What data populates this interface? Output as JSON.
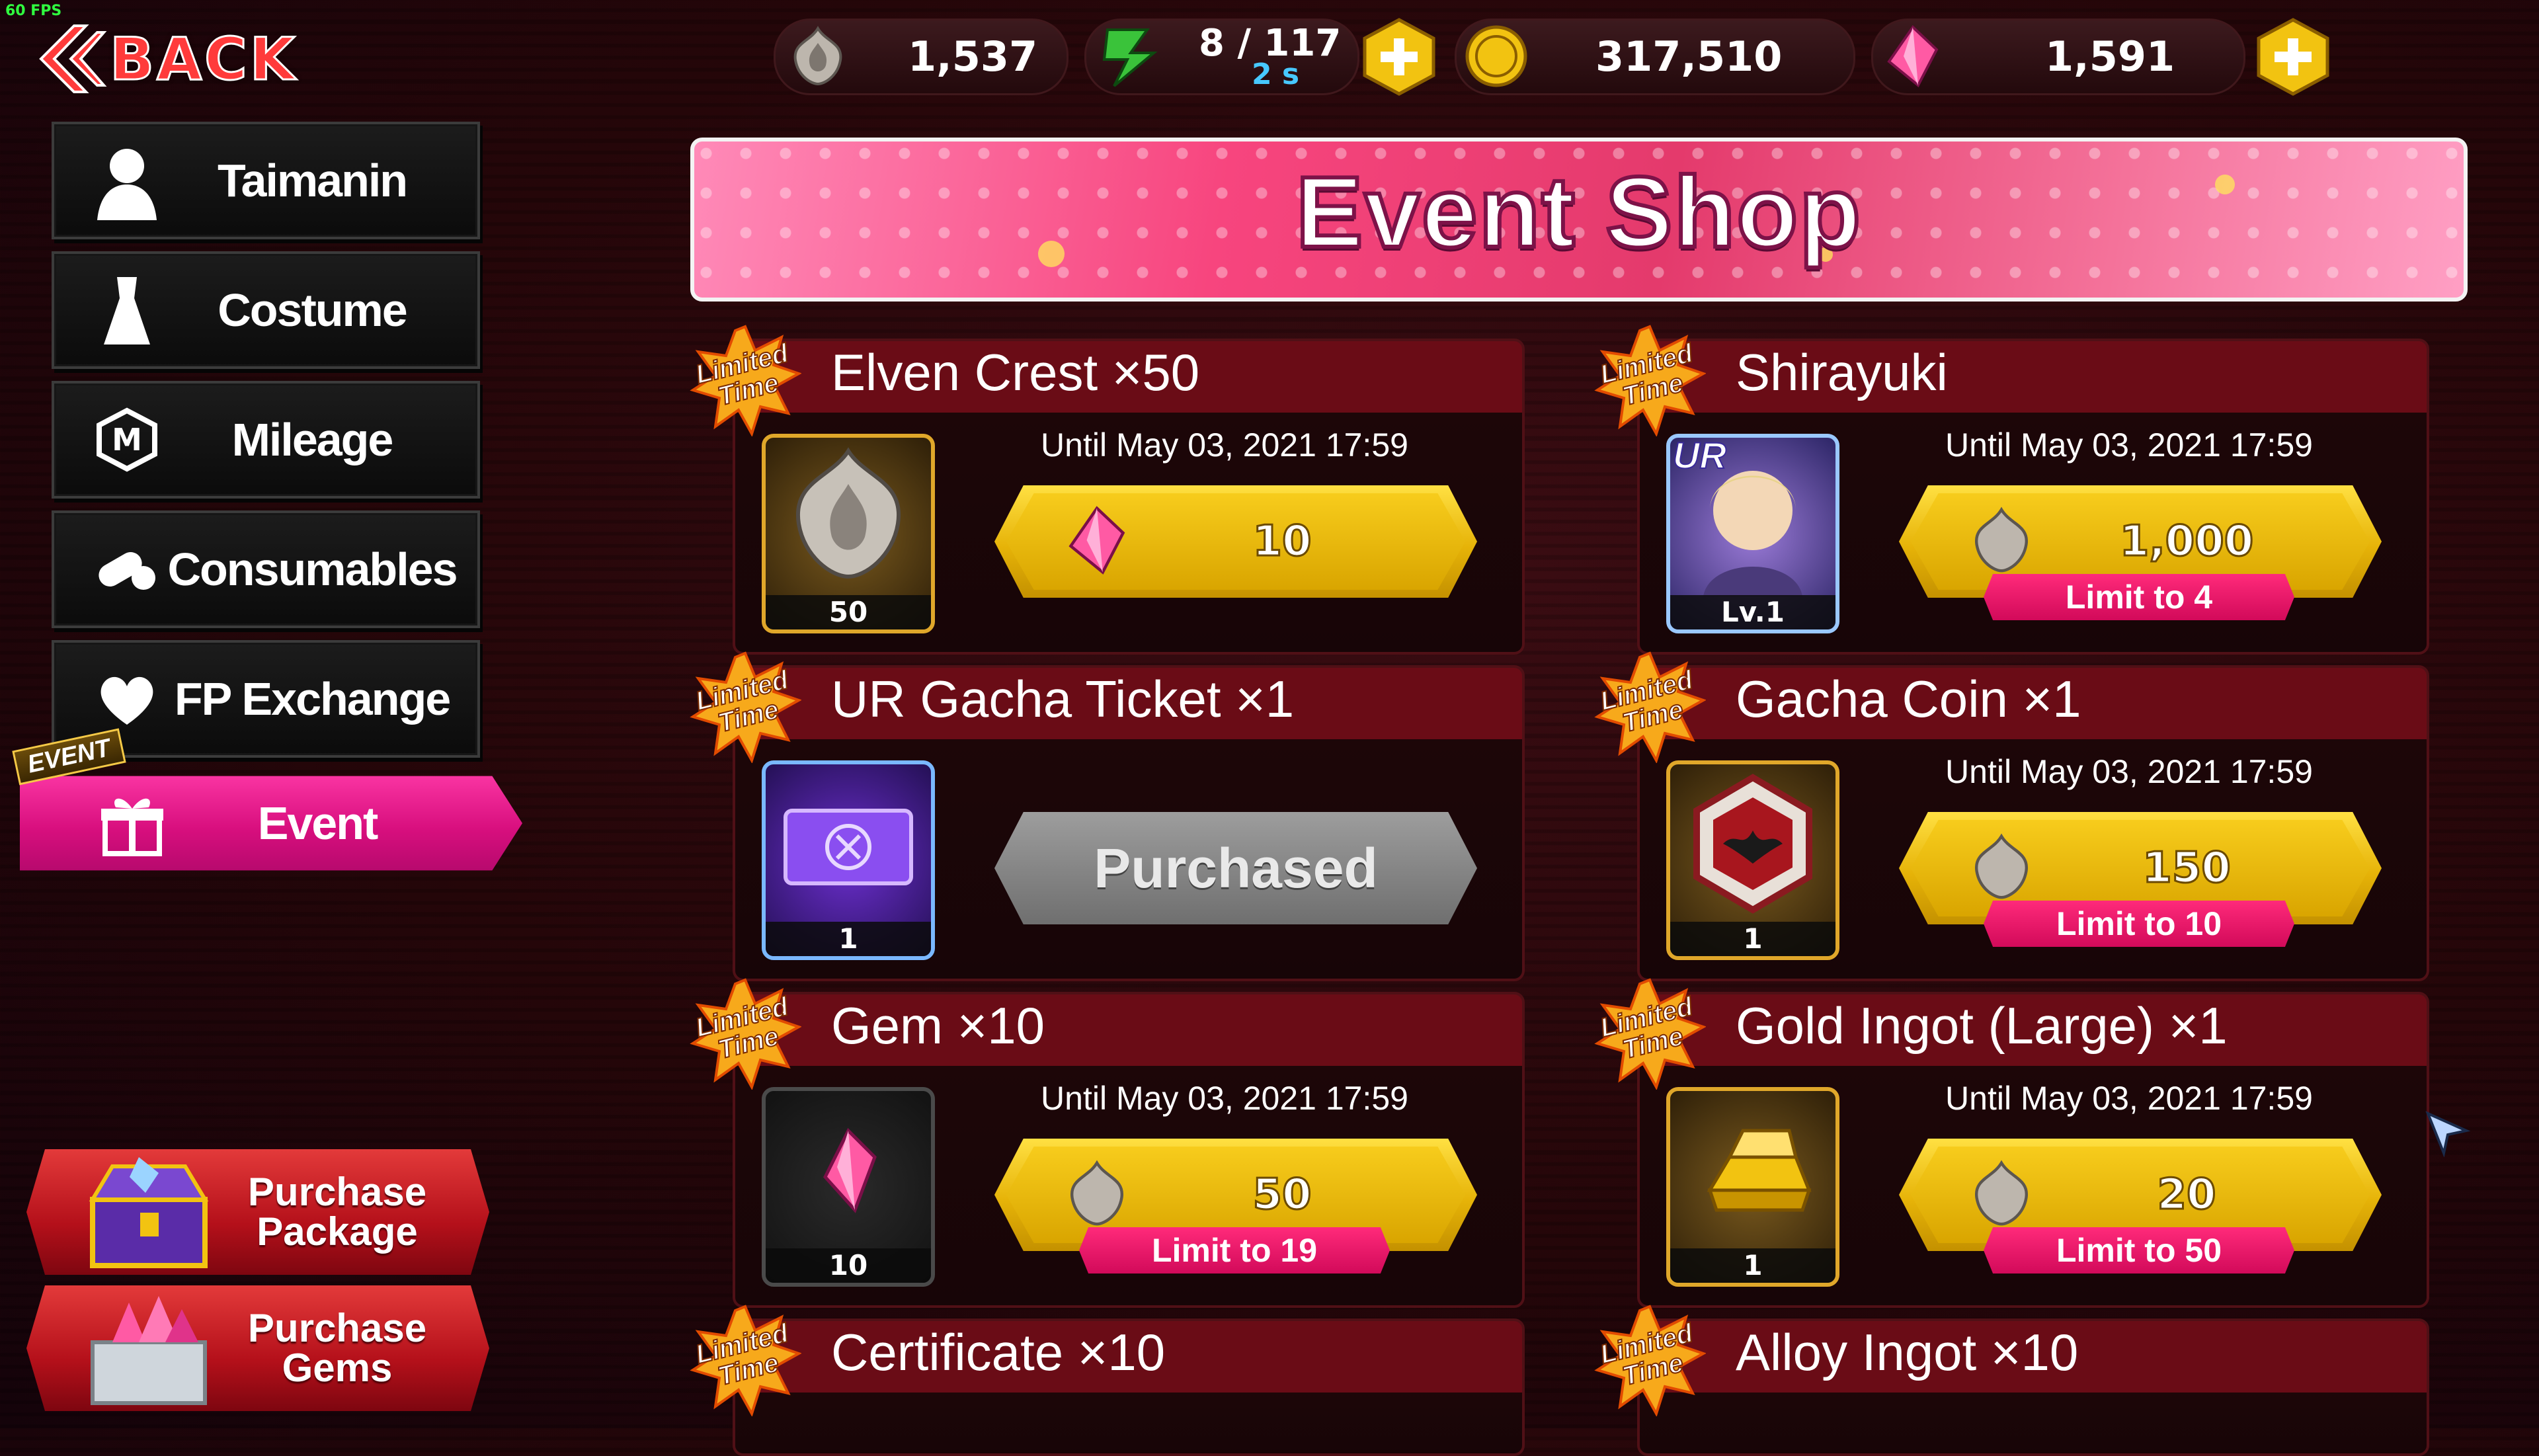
{
  "fps": "60 FPS",
  "back_label": "BACK",
  "topbar": {
    "crest_value": "1,537",
    "ap_value": "8 / 117",
    "ap_label": "AP",
    "ap_timer": "2 s",
    "coin_value": "317,510",
    "gem_value": "1,591"
  },
  "sidebar": {
    "items": [
      {
        "label": "Taimanin",
        "icon": "character-silhouette-icon"
      },
      {
        "label": "Costume",
        "icon": "dress-icon"
      },
      {
        "label": "Mileage",
        "icon": "mileage-icon"
      },
      {
        "label": "Consumables",
        "icon": "pill-icon"
      },
      {
        "label": "FP Exchange",
        "icon": "heart-icon"
      },
      {
        "label": "Event",
        "icon": "gift-icon",
        "tag": "EVENT"
      }
    ],
    "purchase_package": [
      "Purchase",
      "Package"
    ],
    "purchase_gems": [
      "Purchase",
      "Gems"
    ]
  },
  "banner_title": "Event Shop",
  "limited_badge": [
    "Limited",
    "Time"
  ],
  "cards": [
    {
      "title": "Elven Crest ×50",
      "until": "Until May 03, 2021 17:59",
      "count": "50",
      "price": "10",
      "currency": "gem-icon",
      "limit": "",
      "purchased": false
    },
    {
      "title": "Shirayuki",
      "until": "Until May 03, 2021 17:59",
      "count": "Lv.1",
      "badge": "UR",
      "price": "1,000",
      "currency": "crest-icon",
      "limit": "Limit to 4",
      "purchased": false
    },
    {
      "title": "UR Gacha Ticket ×1",
      "until": "",
      "count": "1",
      "price": "",
      "currency": "",
      "limit": "",
      "purchased": true,
      "purchased_label": "Purchased"
    },
    {
      "title": "Gacha Coin ×1",
      "until": "Until May 03, 2021 17:59",
      "count": "1",
      "price": "150",
      "currency": "crest-icon",
      "limit": "Limit to 10",
      "purchased": false
    },
    {
      "title": "Gem ×10",
      "until": "Until May 03, 2021 17:59",
      "count": "10",
      "price": "50",
      "currency": "crest-icon",
      "limit": "Limit to 19",
      "purchased": false
    },
    {
      "title": "Gold Ingot (Large) ×1",
      "until": "Until May 03, 2021 17:59",
      "count": "1",
      "price": "20",
      "currency": "crest-icon",
      "limit": "Limit to 50",
      "purchased": false
    },
    {
      "title": "Certificate ×10"
    },
    {
      "title": "Alloy Ingot ×10"
    }
  ],
  "colors": {
    "accent_pink": "#e0137f",
    "gold": "#f2c311",
    "card_header": "#6a0c16"
  }
}
